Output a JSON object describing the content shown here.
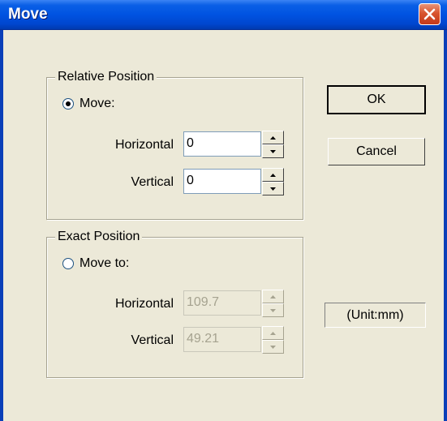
{
  "window": {
    "title": "Move"
  },
  "relative_position": {
    "legend": "Relative Position",
    "radio_label": "Move:",
    "radio_selected": true,
    "horizontal_label": "Horizontal",
    "horizontal_value": "0",
    "vertical_label": "Vertical",
    "vertical_value": "0"
  },
  "exact_position": {
    "legend": "Exact Position",
    "radio_label": "Move to:",
    "radio_selected": false,
    "horizontal_label": "Horizontal",
    "horizontal_value": "109.7",
    "vertical_label": "Vertical",
    "vertical_value": "49.21",
    "enabled": false
  },
  "buttons": {
    "ok_label": "OK",
    "cancel_label": "Cancel"
  },
  "unit_label": "(Unit:mm)",
  "icons": {
    "close": "close-icon",
    "spin_up": "arrow-up-icon",
    "spin_down": "arrow-down-icon"
  },
  "colors": {
    "titlebar": "#0053e1",
    "dialog_face": "#ece9d8",
    "close_button": "#d8542e"
  }
}
